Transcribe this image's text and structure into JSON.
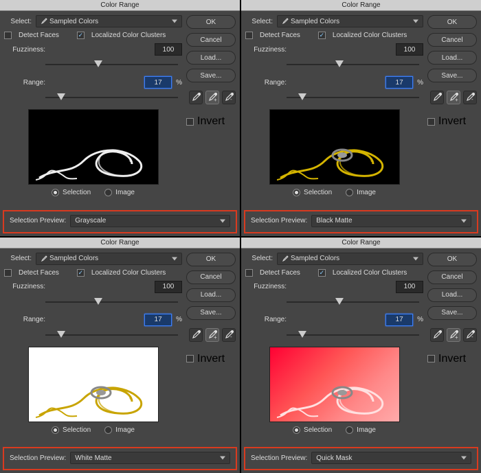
{
  "panels": [
    {
      "selection_preview": "Grayscale",
      "preview_style": "gs"
    },
    {
      "selection_preview": "Black Matte",
      "preview_style": "bm"
    },
    {
      "selection_preview": "White Matte",
      "preview_style": "wm"
    },
    {
      "selection_preview": "Quick Mask",
      "preview_style": "qm"
    }
  ],
  "common": {
    "title": "Color Range",
    "select_label": "Select:",
    "select_value": "Sampled Colors",
    "detect_faces": "Detect Faces",
    "localized": "Localized Color Clusters",
    "fuzziness_label": "Fuzziness:",
    "fuzziness_value": "100",
    "range_label": "Range:",
    "range_value": "17",
    "range_pct": "%",
    "ok": "OK",
    "cancel": "Cancel",
    "load": "Load...",
    "save": "Save...",
    "invert": "Invert",
    "radio_selection": "Selection",
    "radio_image": "Image",
    "selection_preview_label": "Selection Preview:"
  }
}
